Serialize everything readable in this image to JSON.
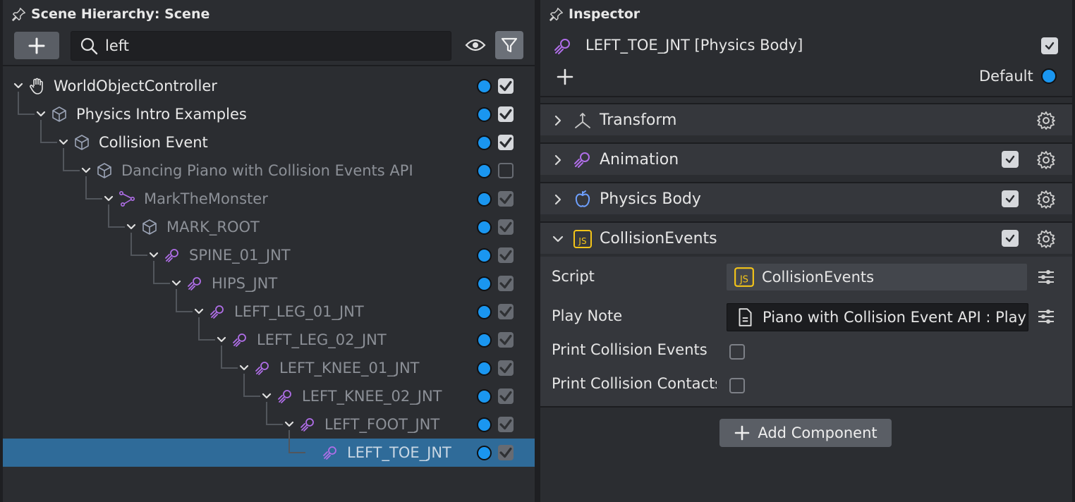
{
  "hierarchy": {
    "title": "Scene Hierarchy: Scene",
    "search_value": "left",
    "nodes": [
      {
        "label": "WorldObjectController",
        "icon": "hand-icon",
        "checked": true
      },
      {
        "label": "Physics Intro Examples",
        "icon": "cube-icon",
        "checked": true
      },
      {
        "label": "Collision Event",
        "icon": "cube-icon",
        "checked": true
      },
      {
        "label": "Dancing Piano with Collision Events API",
        "icon": "cube-icon",
        "checked": false
      },
      {
        "label": "MarkTheMonster",
        "icon": "skeleton-icon",
        "checked": true
      },
      {
        "label": "MARK_ROOT",
        "icon": "cube-icon",
        "checked": true
      },
      {
        "label": "SPINE_01_JNT",
        "icon": "joint-icon",
        "checked": true
      },
      {
        "label": "HIPS_JNT",
        "icon": "joint-icon",
        "checked": true
      },
      {
        "label": "LEFT_LEG_01_JNT",
        "icon": "joint-icon",
        "checked": true
      },
      {
        "label": "LEFT_LEG_02_JNT",
        "icon": "joint-icon",
        "checked": true
      },
      {
        "label": "LEFT_KNEE_01_JNT",
        "icon": "joint-icon",
        "checked": true
      },
      {
        "label": "LEFT_KNEE_02_JNT",
        "icon": "joint-icon",
        "checked": true
      },
      {
        "label": "LEFT_FOOT_JNT",
        "icon": "joint-icon",
        "checked": true
      },
      {
        "label": "LEFT_TOE_JNT",
        "icon": "joint-icon",
        "checked": true
      }
    ]
  },
  "inspector": {
    "title": "Inspector",
    "selected_name": "LEFT_TOE_JNT [Physics Body]",
    "layer_label": "Default",
    "components": {
      "transform": "Transform",
      "animation": "Animation",
      "physics_body": "Physics Body",
      "collision_events": "CollisionEvents"
    },
    "props": {
      "script_label": "Script",
      "script_value": "CollisionEvents",
      "play_note_label": "Play Note",
      "play_note_value": "Piano with Collision Event API : Play",
      "print_events_label": "Print Collision Events",
      "print_contacts_label": "Print Collision Contacts"
    },
    "add_component_label": "Add Component"
  },
  "colors": {
    "accent_blue": "#1a96f0",
    "selection": "#2f6b99",
    "joint_purple": "#b06ee8",
    "script_yellow": "#f5c518"
  }
}
